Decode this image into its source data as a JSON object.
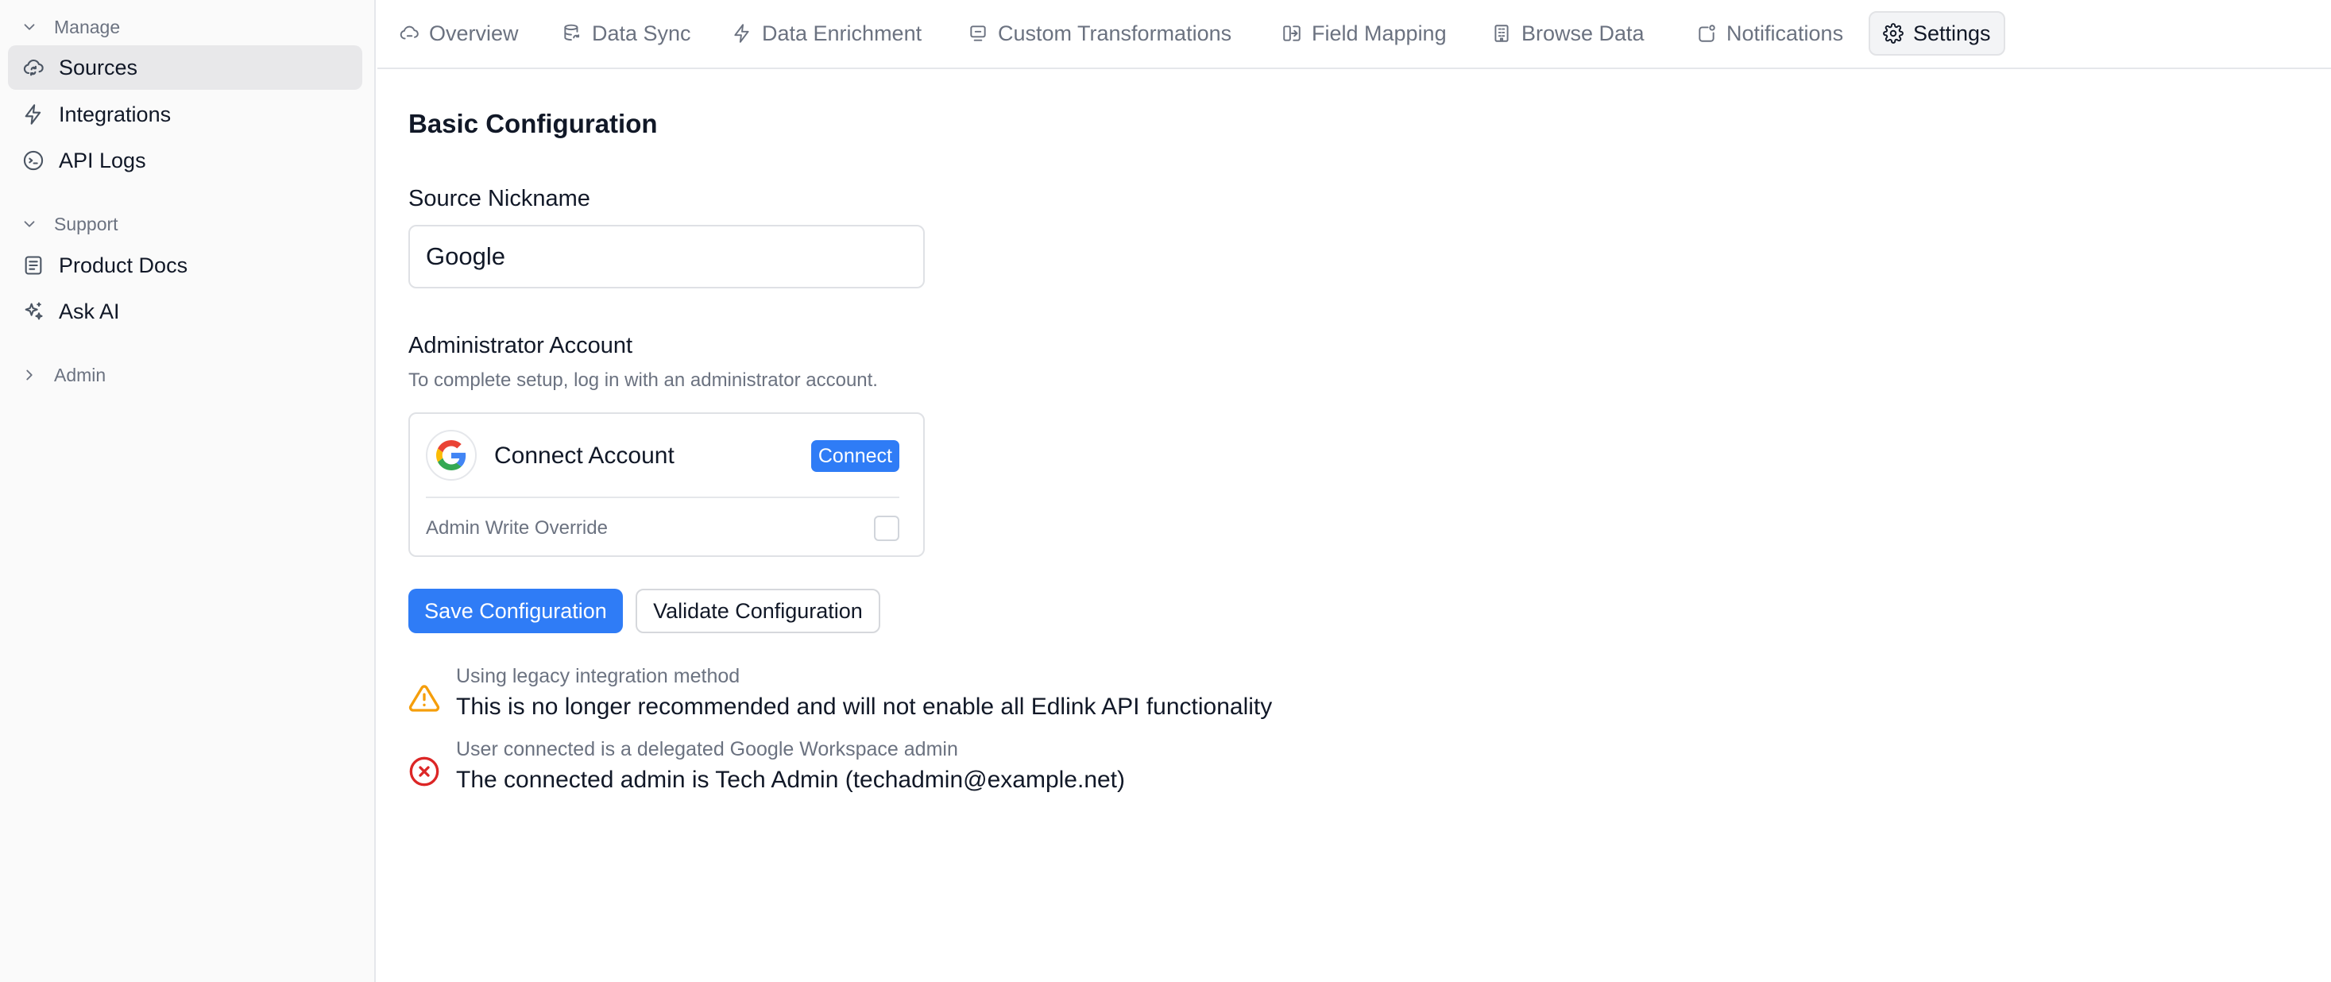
{
  "sidebar": {
    "manage": {
      "label": "Manage",
      "items": [
        {
          "label": "Sources",
          "icon": "cloud-sync-icon",
          "active": true
        },
        {
          "label": "Integrations",
          "icon": "bolt-icon"
        },
        {
          "label": "API Logs",
          "icon": "terminal-icon"
        }
      ]
    },
    "support": {
      "label": "Support",
      "items": [
        {
          "label": "Product Docs",
          "icon": "document-icon"
        },
        {
          "label": "Ask AI",
          "icon": "sparkles-icon"
        }
      ]
    },
    "admin": {
      "label": "Admin"
    }
  },
  "tabs": [
    {
      "label": "Overview",
      "icon": "cloud-icon"
    },
    {
      "label": "Data Sync",
      "icon": "database-sync-icon"
    },
    {
      "label": "Data Enrichment",
      "icon": "bolt-icon"
    },
    {
      "label": "Custom Transformations",
      "icon": "transform-icon"
    },
    {
      "label": "Field Mapping",
      "icon": "mapping-icon"
    },
    {
      "label": "Browse Data",
      "icon": "building-icon"
    },
    {
      "label": "Notifications",
      "icon": "bell-dot-icon"
    },
    {
      "label": "Settings",
      "icon": "gear-icon",
      "active": true
    }
  ],
  "basic": {
    "heading": "Basic Configuration",
    "nickname_label": "Source Nickname",
    "nickname_value": "Google"
  },
  "admin_account": {
    "heading": "Administrator Account",
    "hint": "To complete setup, log in with an administrator account.",
    "connect_label": "Connect Account",
    "connect_button": "Connect",
    "override_label": "Admin Write Override",
    "override_checked": false
  },
  "actions": {
    "save": "Save Configuration",
    "validate": "Validate Configuration"
  },
  "alerts": [
    {
      "type": "warning",
      "icon": "warning-triangle-icon",
      "color": "#f59e0b",
      "title": "Using legacy integration method",
      "message": "This is no longer recommended and will not enable all Edlink API functionality"
    },
    {
      "type": "error",
      "icon": "error-circle-icon",
      "color": "#dc2626",
      "title": "User connected is a delegated Google Workspace admin",
      "message": "The connected admin is Tech Admin (techadmin@example.net)"
    }
  ],
  "colors": {
    "primary": "#2f7cf6",
    "warning": "#f59e0b",
    "error": "#dc2626"
  }
}
